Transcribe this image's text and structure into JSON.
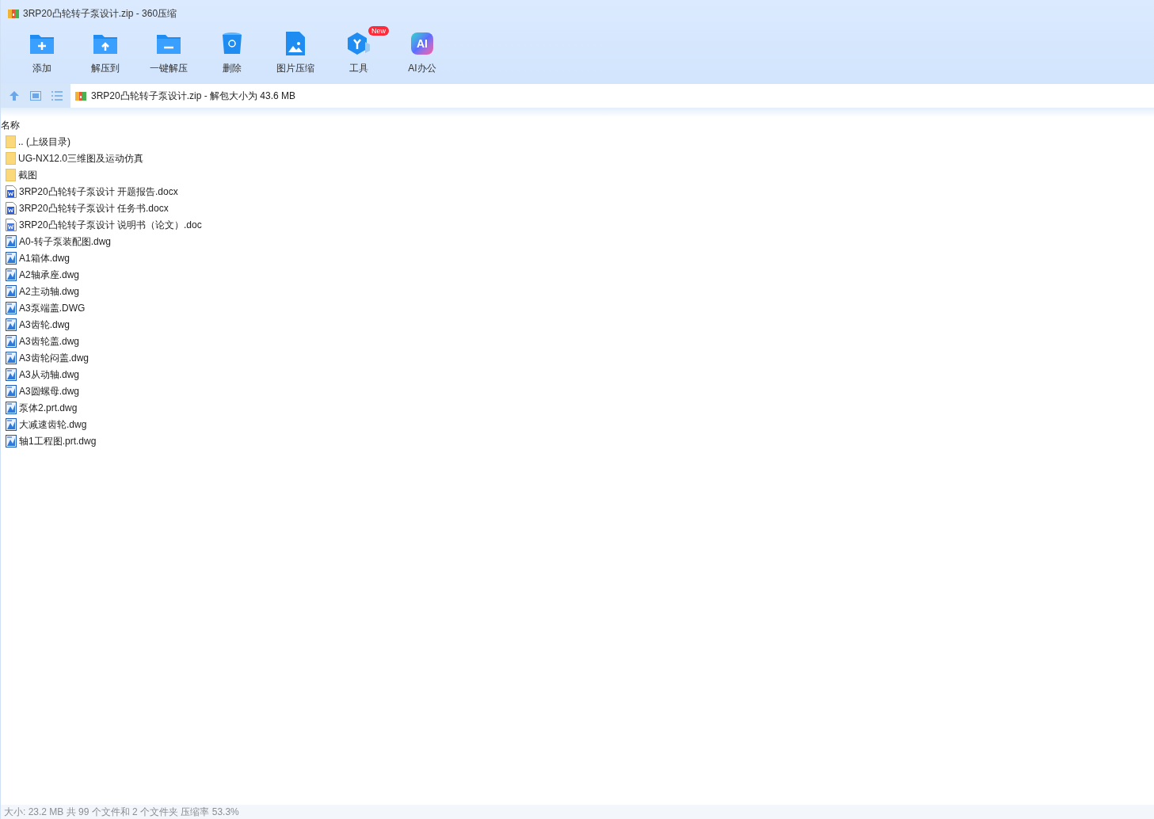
{
  "window": {
    "title": "3RP20凸轮转子泵设计.zip - 360压缩"
  },
  "toolbar": [
    {
      "kind": "add",
      "label": "添加"
    },
    {
      "kind": "extract",
      "label": "解压到"
    },
    {
      "kind": "oneclick",
      "label": "一键解压"
    },
    {
      "kind": "delete",
      "label": "删除"
    },
    {
      "kind": "image",
      "label": "图片压缩"
    },
    {
      "kind": "tools",
      "label": "工具",
      "badge": "New"
    },
    {
      "kind": "ai",
      "label": "AI办公",
      "icon_text": "AI"
    }
  ],
  "address_bar": {
    "value": "3RP20凸轮转子泵设计.zip - 解包大小为 43.6 MB"
  },
  "file_list": {
    "columns": [
      "名称"
    ],
    "rows": [
      {
        "kind": "folder",
        "name": ".. (上级目录)"
      },
      {
        "kind": "folder",
        "name": "UG-NX12.0三维图及运动仿真"
      },
      {
        "kind": "folder",
        "name": "截图"
      },
      {
        "kind": "docx",
        "name": "3RP20凸轮转子泵设计 开题报告.docx"
      },
      {
        "kind": "docx",
        "name": "3RP20凸轮转子泵设计 任务书.docx"
      },
      {
        "kind": "doc",
        "name": "3RP20凸轮转子泵设计 说明书（论文）.doc"
      },
      {
        "kind": "dwg",
        "name": "A0-转子泵装配图.dwg"
      },
      {
        "kind": "dwg",
        "name": "A1箱体.dwg"
      },
      {
        "kind": "dwg",
        "name": "A2轴承座.dwg"
      },
      {
        "kind": "dwg",
        "name": "A2主动轴.dwg"
      },
      {
        "kind": "dwg",
        "name": "A3泵端盖.DWG"
      },
      {
        "kind": "dwg",
        "name": "A3齿轮.dwg"
      },
      {
        "kind": "dwg",
        "name": "A3齿轮盖.dwg"
      },
      {
        "kind": "dwg",
        "name": "A3齿轮闷盖.dwg"
      },
      {
        "kind": "dwg",
        "name": "A3从动轴.dwg"
      },
      {
        "kind": "dwg",
        "name": "A3圆螺母.dwg"
      },
      {
        "kind": "dwg",
        "name": "泵体2.prt.dwg"
      },
      {
        "kind": "dwg",
        "name": "大减速齿轮.dwg"
      },
      {
        "kind": "dwg",
        "name": "轴1工程图.prt.dwg"
      }
    ]
  },
  "status_bar": "大小: 23.2 MB 共 99 个文件和 2 个文件夹 压缩率 53.3%"
}
